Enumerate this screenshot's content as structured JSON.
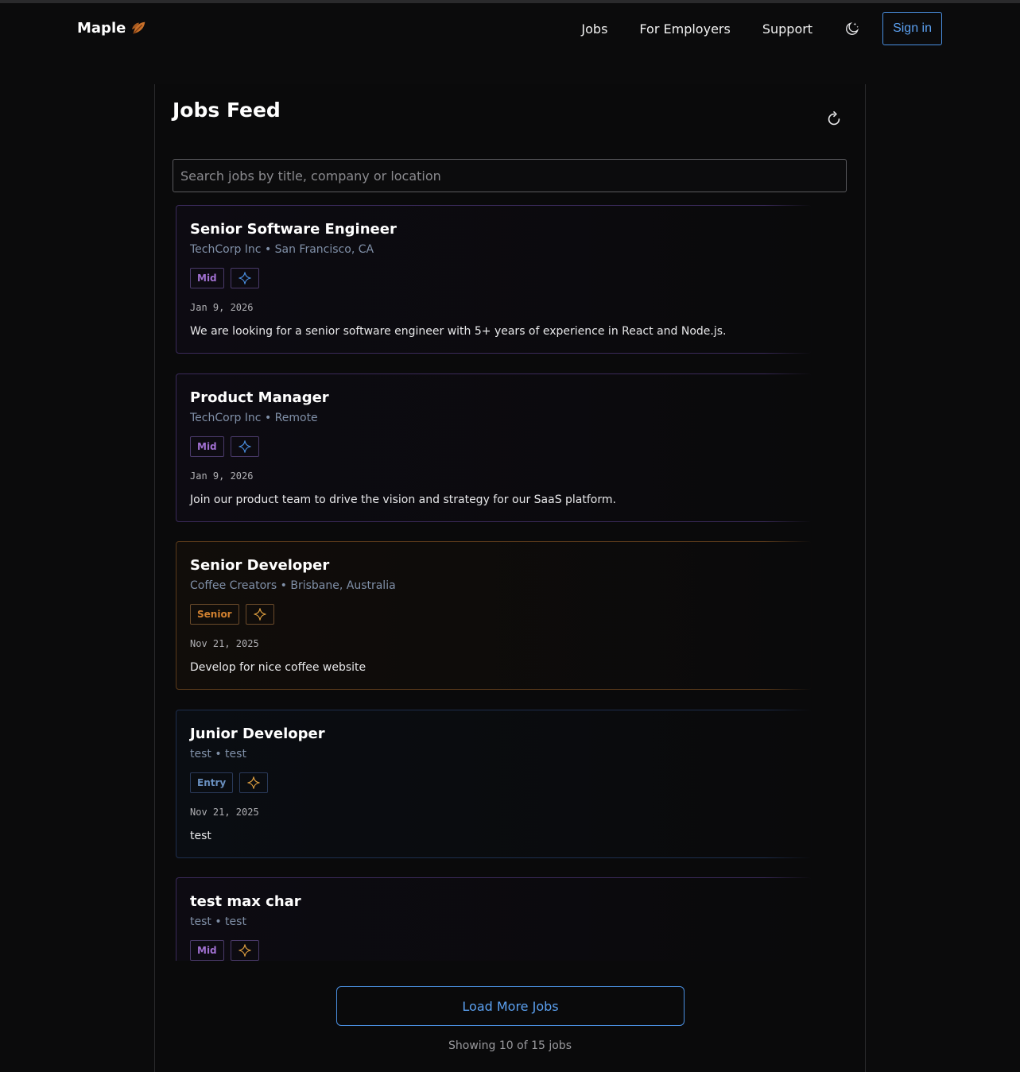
{
  "header": {
    "logo_text": "Maple",
    "nav": [
      "Jobs",
      "For Employers",
      "Support"
    ],
    "sign_in": "Sign in"
  },
  "main": {
    "title": "Jobs Feed",
    "search_placeholder": "Search jobs by title, company or location",
    "jobs": [
      {
        "title": "Senior Software Engineer",
        "meta": "TechCorp Inc • San Francisco, CA",
        "level": "Mid",
        "date": "Jan 9, 2026",
        "description": "We are looking for a senior software engineer with 5+ years of experience in React and Node.js."
      },
      {
        "title": "Product Manager",
        "meta": "TechCorp Inc • Remote",
        "level": "Mid",
        "date": "Jan 9, 2026",
        "description": "Join our product team to drive the vision and strategy for our SaaS platform."
      },
      {
        "title": "Senior Developer",
        "meta": "Coffee Creators • Brisbane, Australia",
        "level": "Senior",
        "date": "Nov 21, 2025",
        "description": "Develop for nice coffee website"
      },
      {
        "title": "Junior Developer",
        "meta": "test • test",
        "level": "Entry",
        "date": "Nov 21, 2025",
        "description": "test"
      },
      {
        "title": "test max char",
        "meta": "test • test",
        "level": "Mid",
        "date": "",
        "description": ""
      }
    ],
    "load_more": "Load More Jobs",
    "showing": "Showing 10 of 15 jobs"
  },
  "colors": {
    "accent_blue": "#4a8fe0",
    "mid_purple": "#a070d0",
    "senior_orange": "#d08030",
    "entry_blue": "#6a90c0"
  },
  "icons": [
    "leaf-icon",
    "moon-icon",
    "refresh-icon",
    "sparkle-icon",
    "more-vertical-icon"
  ]
}
